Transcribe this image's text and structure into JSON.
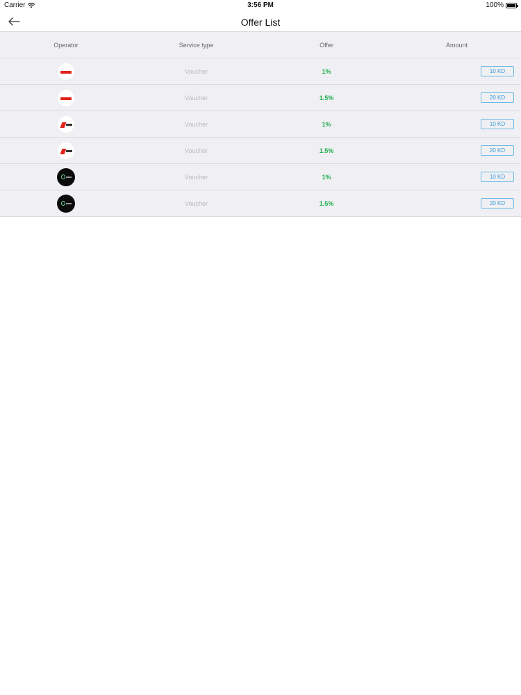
{
  "status_bar": {
    "carrier": "Carrier",
    "time": "3:56 PM",
    "battery": "100%"
  },
  "nav": {
    "title": "Offer List"
  },
  "table": {
    "headers": {
      "operator": "Operator",
      "service_type": "Service type",
      "offer": "Offer",
      "amount": "Amount"
    },
    "rows": [
      {
        "operator_logo": "ooredoo-logo",
        "service_type": "Voucher",
        "offer": "1%",
        "amount": "10 KD"
      },
      {
        "operator_logo": "ooredoo-logo",
        "service_type": "Voucher",
        "offer": "1.5%",
        "amount": "20 KD"
      },
      {
        "operator_logo": "viva-logo",
        "service_type": "Voucher",
        "offer": "1%",
        "amount": "10 KD"
      },
      {
        "operator_logo": "viva-logo",
        "service_type": "Voucher",
        "offer": "1.5%",
        "amount": "20 KD"
      },
      {
        "operator_logo": "zain-logo",
        "service_type": "Voucher",
        "offer": "1%",
        "amount": "10 KD"
      },
      {
        "operator_logo": "zain-logo",
        "service_type": "Voucher",
        "offer": "1.5%",
        "amount": "20 KD"
      }
    ]
  },
  "colors": {
    "offer_green": "#1fae4b",
    "amount_blue": "#3a9ad6",
    "table_bg": "#f0f0f4"
  }
}
